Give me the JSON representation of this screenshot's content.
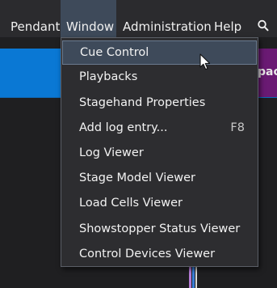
{
  "menubar": {
    "items": [
      {
        "label": "Pendant"
      },
      {
        "label": "Window"
      },
      {
        "label": "Administration"
      },
      {
        "label": "Help"
      }
    ],
    "search_icon": "search-icon"
  },
  "background": {
    "purple_tab_text": "pack"
  },
  "window_menu": {
    "items": [
      {
        "label": "Cue Control",
        "shortcut": ""
      },
      {
        "label": "Playbacks",
        "shortcut": ""
      },
      {
        "label": "Stagehand Properties",
        "shortcut": ""
      },
      {
        "label": "Add log entry...",
        "shortcut": "F8"
      },
      {
        "label": "Log Viewer",
        "shortcut": ""
      },
      {
        "label": "Stage Model Viewer",
        "shortcut": ""
      },
      {
        "label": "Load Cells Viewer",
        "shortcut": ""
      },
      {
        "label": "Showstopper Status Viewer",
        "shortcut": ""
      },
      {
        "label": "Control Devices Viewer",
        "shortcut": ""
      }
    ],
    "highlighted": "Cue Control"
  },
  "colors": {
    "menubar_bg": "#2b2b2e",
    "menu_bg": "#2d2d30",
    "highlight": "#3e4a5a",
    "accent_blue": "#0a78d4",
    "purple": "#6a1a73"
  }
}
